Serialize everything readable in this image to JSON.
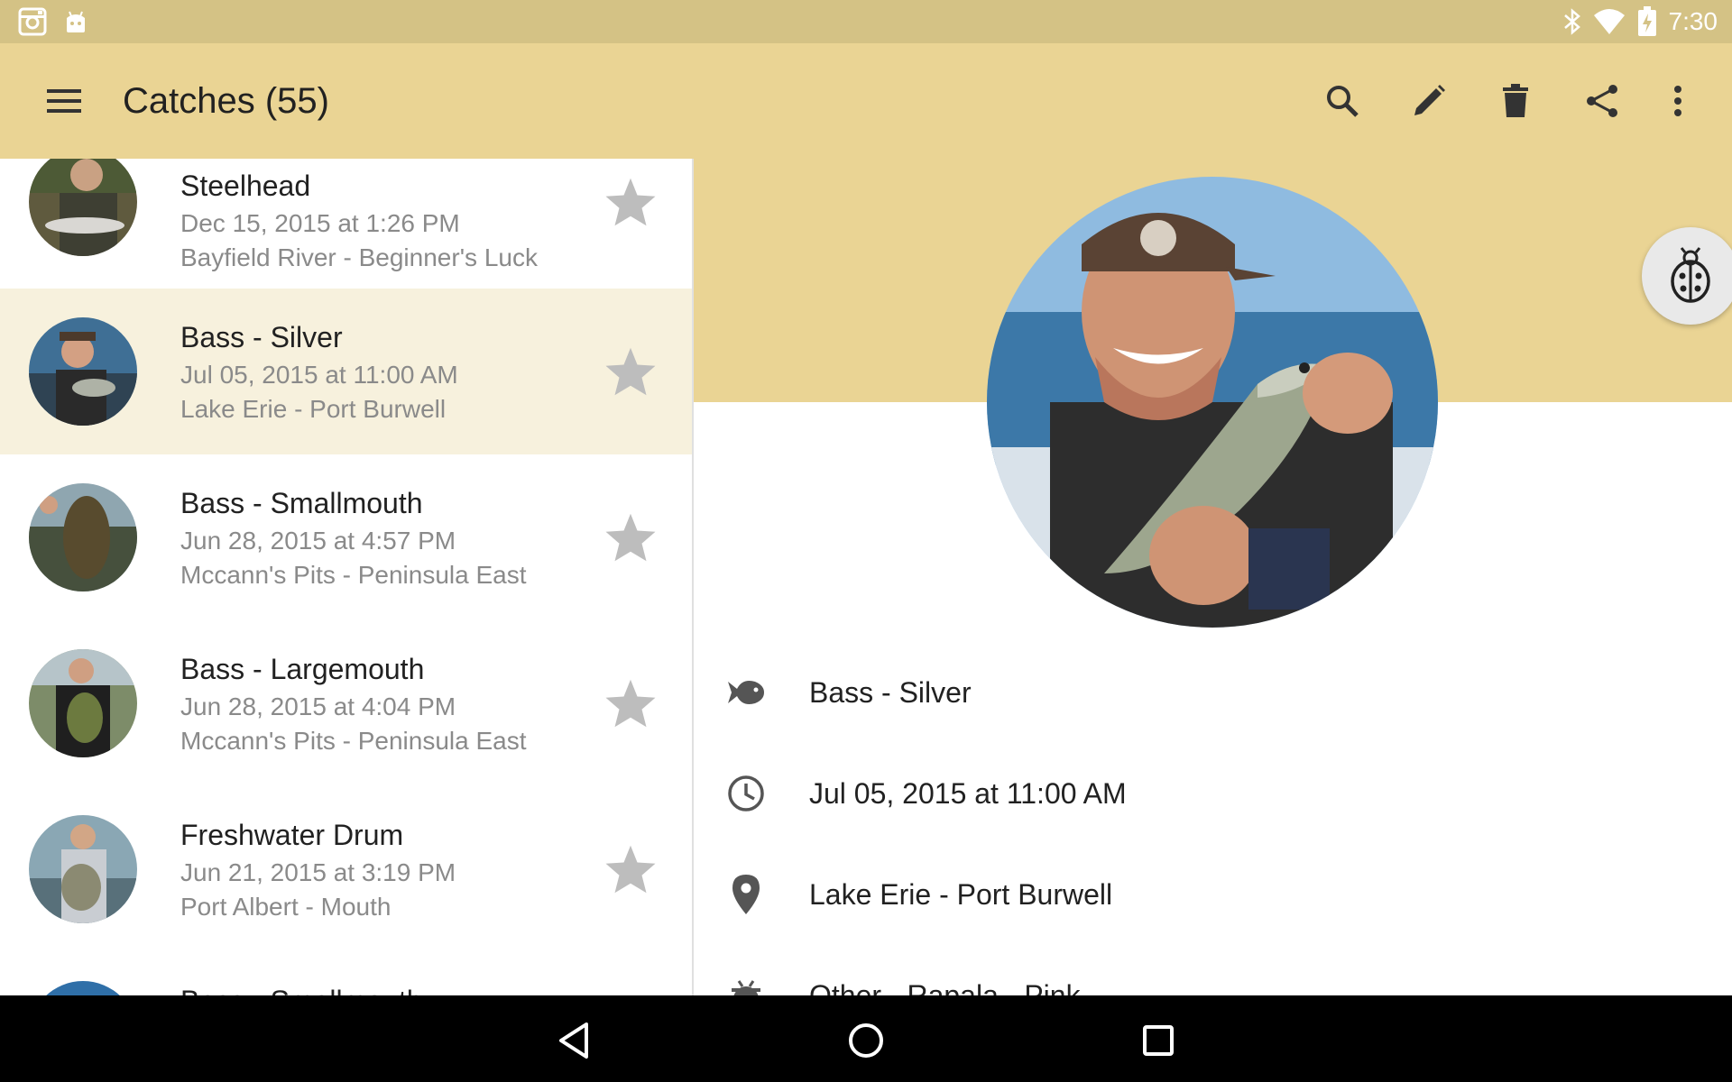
{
  "status_bar": {
    "time": "7:30",
    "left_icons": [
      "instagram-icon",
      "android-icon"
    ],
    "right_icons": [
      "bluetooth-icon",
      "wifi-icon",
      "battery-icon"
    ]
  },
  "app_bar": {
    "title": "Catches (55)",
    "actions": [
      "search-icon",
      "edit-icon",
      "delete-icon",
      "share-icon",
      "more-vert-icon"
    ]
  },
  "catches": [
    {
      "species": "Steelhead",
      "datetime": "Dec 15, 2015 at 1:26 PM",
      "location": "Bayfield River - Beginner's Luck",
      "selected": false
    },
    {
      "species": "Bass - Silver",
      "datetime": "Jul 05, 2015 at 11:00 AM",
      "location": "Lake Erie - Port Burwell",
      "selected": true
    },
    {
      "species": "Bass - Smallmouth",
      "datetime": "Jun 28, 2015 at 4:57 PM",
      "location": "Mccann's Pits - Peninsula East",
      "selected": false
    },
    {
      "species": "Bass - Largemouth",
      "datetime": "Jun 28, 2015 at 4:04 PM",
      "location": "Mccann's Pits - Peninsula East",
      "selected": false
    },
    {
      "species": "Freshwater Drum",
      "datetime": "Jun 21, 2015 at 3:19 PM",
      "location": "Port Albert - Mouth",
      "selected": false
    },
    {
      "species": "Bass - Smallmouth",
      "datetime": "",
      "location": "",
      "selected": false
    }
  ],
  "detail": {
    "species": "Bass - Silver",
    "datetime": "Jul 05, 2015 at 11:00 AM",
    "location": "Lake Erie - Port Burwell",
    "bait": "Other - Rapala - Pink"
  },
  "colors": {
    "status_bar": "#d4c285",
    "app_bar": "#ead494",
    "selected_row": "#f7f1dd",
    "star": "#bdbdbd"
  }
}
